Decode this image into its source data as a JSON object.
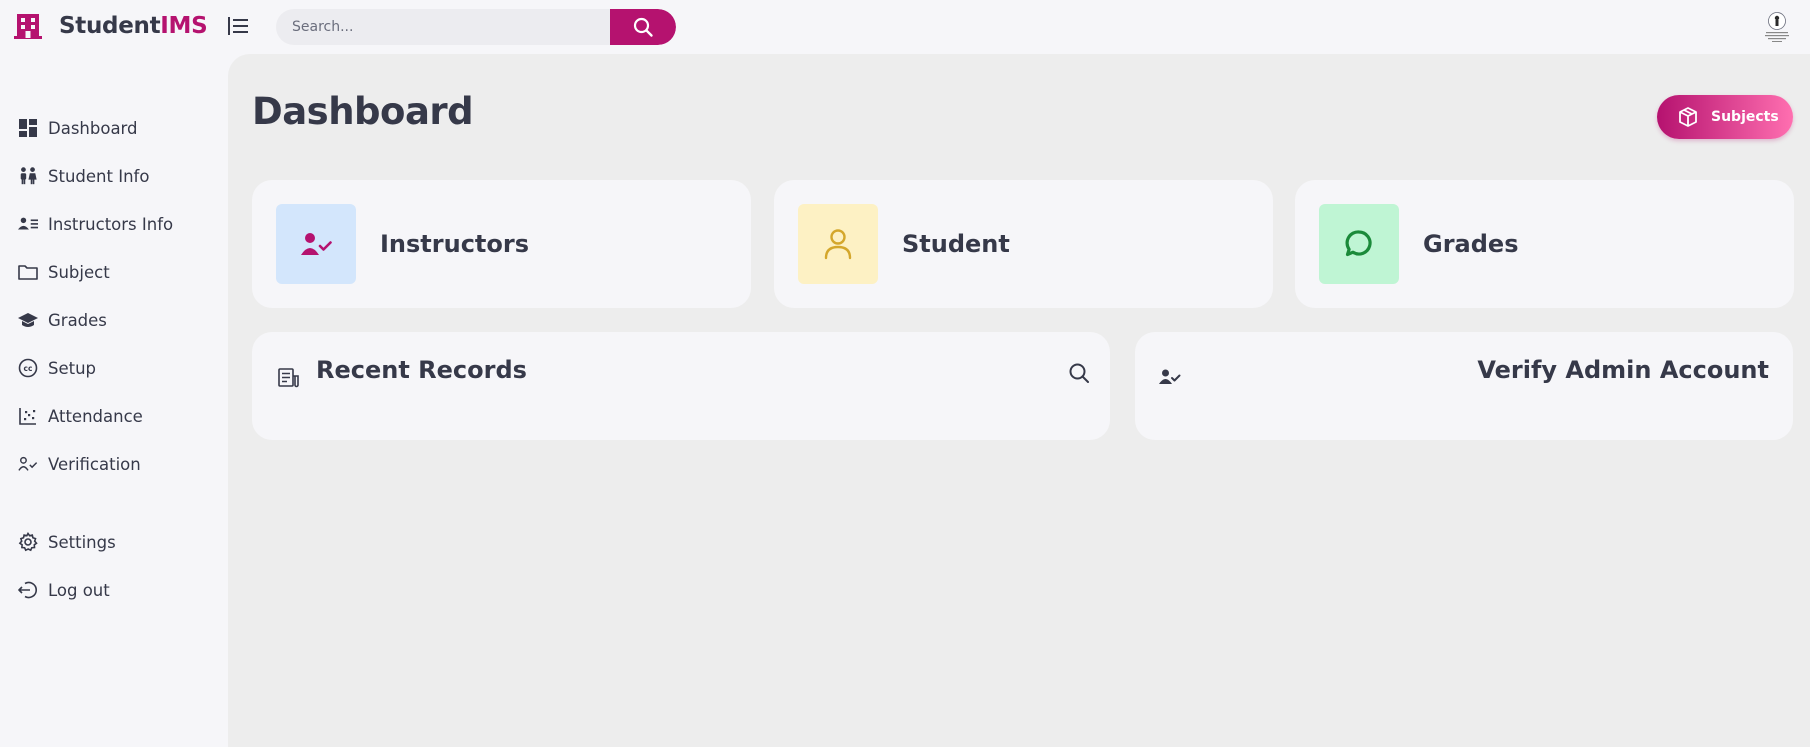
{
  "brand": {
    "part1": "Student",
    "part2": "IMS"
  },
  "search": {
    "placeholder": "Search..."
  },
  "sidebar": {
    "items": [
      {
        "label": "Dashboard",
        "icon": "dashboard-icon"
      },
      {
        "label": "Student Info",
        "icon": "people-icon"
      },
      {
        "label": "Instructors Info",
        "icon": "contacts-icon"
      },
      {
        "label": "Subject",
        "icon": "folder-icon"
      },
      {
        "label": "Grades",
        "icon": "graduation-cap-icon"
      },
      {
        "label": "Setup",
        "icon": "cc-icon"
      },
      {
        "label": "Attendance",
        "icon": "scatter-chart-icon"
      },
      {
        "label": "Verification",
        "icon": "person-check-icon"
      },
      {
        "label": "Settings",
        "icon": "gear-icon"
      },
      {
        "label": "Log out",
        "icon": "logout-icon"
      }
    ]
  },
  "main": {
    "title": "Dashboard",
    "subjects_button": "Subjects",
    "cards": [
      {
        "label": "Instructors",
        "icon": "person-check-icon",
        "bg": "#d3e6fc",
        "color": "#b5126f"
      },
      {
        "label": "Student",
        "icon": "person-icon",
        "bg": "#fdf1c4",
        "color": "#d4a72c"
      },
      {
        "label": "Grades",
        "icon": "chat-bubble-icon",
        "bg": "#bff5d4",
        "color": "#1b8a3a"
      }
    ],
    "recent_records": {
      "title": "Recent Records",
      "icon": "receipt-icon"
    },
    "verify_admin": {
      "title": "Verify Admin Account",
      "icon": "person-check-icon"
    }
  },
  "colors": {
    "accent": "#b5126f",
    "background": "#f6f6f9",
    "main_bg": "#ededed",
    "text": "#363949"
  }
}
